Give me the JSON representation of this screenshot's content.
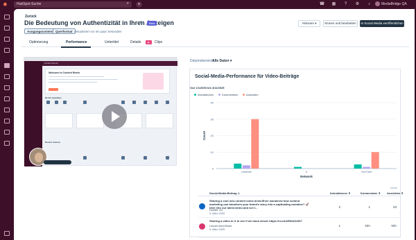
{
  "topbar": {
    "search_placeholder": "HubSpot-Suche",
    "account_name": "MediaBridge QA"
  },
  "header": {
    "back_label": "Zurück",
    "title": "Die Bedeutung von Authentizität in Ihren Anzeigen",
    "beta_label": "Beta",
    "tags": [
      "Ausgangscontent",
      "Querformat"
    ],
    "updated_text": "Aktualisiert vor ein paar Sekunden",
    "actions_label": "Aktionen",
    "clone_label": "Klonen und bearbeiten",
    "publish_label": "In Social Media veröffentlichen"
  },
  "tabs": [
    {
      "label": "Optimierung"
    },
    {
      "label": "Performance"
    },
    {
      "label": "Untertitel"
    },
    {
      "label": "Details"
    },
    {
      "label": "Clips"
    }
  ],
  "video_preview": {
    "app_header": "Content Remix",
    "welcome_title": "Welcome to Content Remix",
    "section_templates": "Remix templates",
    "section_recent": "Recent remixes"
  },
  "filters": {
    "date_range_label": "Datumsbereich:",
    "date_range_value": "Alle Daten"
  },
  "performance": {
    "panel_title": "Social-Media-Performance für Video-Beiträge",
    "date_range": "Von 1/1/2000 bis 4/11/2025"
  },
  "chart_data": {
    "type": "bar",
    "categories": [
      "LinkedIn",
      "X",
      "YouTube"
    ],
    "series": [
      {
        "name": "Interaktionen",
        "color": "#00bda5",
        "values": [
          3,
          1,
          2.5
        ]
      },
      {
        "name": "Kommentare",
        "color": "#b7a5f0",
        "values": [
          2,
          0,
          1
        ]
      },
      {
        "name": "Ansichten",
        "color": "#ff8f80",
        "values": [
          30,
          0,
          10
        ]
      }
    ],
    "xlabel": "Network",
    "ylabel": "Count",
    "ylim": [
      0,
      40
    ],
    "yticks": [
      0,
      10,
      20,
      30,
      40
    ],
    "grid": true,
    "legend": "top-left"
  },
  "table": {
    "headers": [
      "Social-Media-Beitrag",
      "Interaktionen",
      "Kommentare",
      "Ansichten"
    ],
    "rows": [
      {
        "text": "Sharing a cool new content remix demo!Ever wondered how content marketing can transform your brand's story into a captivating narrative? 🚀 Dive into our latest demo and see t...",
        "author": "Dunder, Inc",
        "date": "5. März 2025",
        "interactions": "2",
        "comments": "1",
        "views": "23",
        "icon_color": "#0a66c2"
      },
      {
        "text": "Sharing a video to X to see if we track views! https://t.co/LkEWcDnD67",
        "author": "Lincoln InboxTester",
        "date": "6. März 2025",
        "interactions": "1",
        "comments": "N/A",
        "views": "N/A",
        "icon_color": "#d9366b"
      }
    ]
  }
}
